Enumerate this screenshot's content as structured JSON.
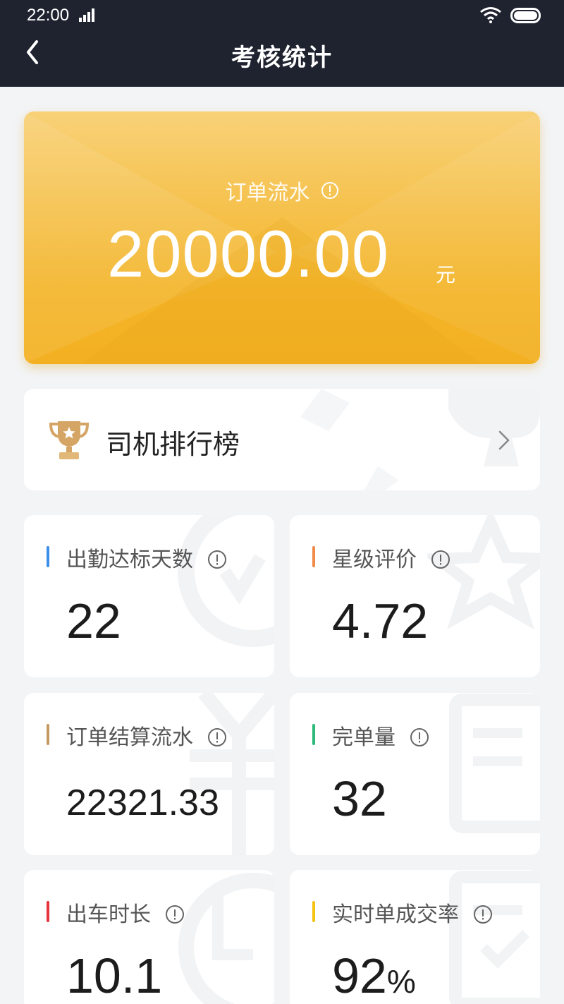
{
  "status_bar": {
    "time": "22:00"
  },
  "header": {
    "title": "考核统计"
  },
  "revenue": {
    "label": "订单流水",
    "value": "20000.00",
    "unit": "元"
  },
  "ranking": {
    "label": "司机排行榜"
  },
  "stats": [
    {
      "label": "出勤达标天数",
      "value": "22",
      "accent": "#3b8fe8"
    },
    {
      "label": "星级评价",
      "value": "4.72",
      "accent": "#f08b4a"
    },
    {
      "label": "订单结算流水",
      "value": "22321.33",
      "accent": "#c59a61"
    },
    {
      "label": "完单量",
      "value": "32",
      "accent": "#2cba7a"
    },
    {
      "label": "出车时长",
      "value": "10.1",
      "accent": "#e8343e"
    },
    {
      "label": "实时单成交率",
      "value": "92",
      "suffix": "%",
      "accent": "#f5c211"
    }
  ],
  "colors": {
    "header_bg": "#1f2330",
    "revenue_card": "#f4b52a",
    "page_bg": "#f3f4f6"
  },
  "icons": [
    "signal-icon",
    "wifi-icon",
    "battery-icon",
    "back-icon",
    "info-icon",
    "trophy-icon",
    "chevron-right-icon"
  ]
}
